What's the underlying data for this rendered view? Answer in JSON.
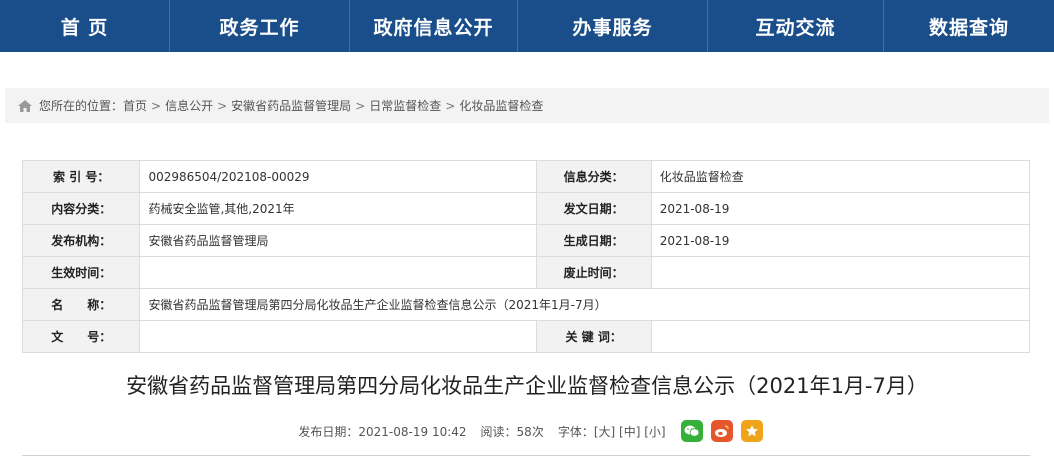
{
  "nav": {
    "items": [
      {
        "label": "首 页"
      },
      {
        "label": "政务工作"
      },
      {
        "label": "政府信息公开"
      },
      {
        "label": "办事服务"
      },
      {
        "label": "互动交流"
      },
      {
        "label": "数据查询"
      }
    ]
  },
  "breadcrumb": {
    "prefix": "您所在的位置：",
    "sep": ">",
    "items": [
      "首页",
      "信息公开",
      "安徽省药品监督管理局",
      "日常监督检查",
      "化妆品监督检查"
    ]
  },
  "meta": {
    "index_label": "索 引 号：",
    "index_value": "002986504/202108-00029",
    "category_label": "信息分类：",
    "category_value": "化妆品监督检查",
    "content_type_label": "内容分类：",
    "content_type_value": "药械安全监管,其他,2021年",
    "issue_date_label": "发文日期：",
    "issue_date_value": "2021-08-19",
    "publisher_label": "发布机构：",
    "publisher_value": "安徽省药品监督管理局",
    "created_label": "生成日期：",
    "created_value": "2021-08-19",
    "effective_label": "生效时间：",
    "effective_value": "",
    "expire_label": "废止时间：",
    "expire_value": "",
    "name_label": "名　　称：",
    "name_value": "安徽省药品监督管理局第四分局化妆品生产企业监督检查信息公示（2021年1月-7月）",
    "docno_label": "文　　号：",
    "docno_value": "",
    "keyword_label": "关 键 词：",
    "keyword_value": ""
  },
  "article": {
    "title": "安徽省药品监督管理局第四分局化妆品生产企业监督检查信息公示（2021年1月-7月）",
    "publish_label": "发布日期：",
    "publish_value": "2021-08-19 10:42",
    "views_label": "阅读：",
    "views_value": "58次",
    "font_label": "字体：",
    "font_large": "[大]",
    "font_medium": "[中]",
    "font_small": "[小]"
  },
  "colors": {
    "nav_bg": "#1a4e8a",
    "wechat": "#35b13a",
    "weibo": "#e6552b",
    "favorite": "#f0a41a"
  },
  "icons": [
    "home-icon",
    "wechat-icon",
    "weibo-icon",
    "star-icon"
  ]
}
